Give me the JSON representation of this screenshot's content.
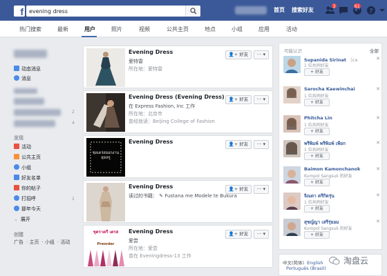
{
  "header": {
    "search_value": "evening dress",
    "home_label": "首页",
    "find_friends_label": "搜索好友",
    "friend_requests_badge": "3",
    "notifications_badge": "61"
  },
  "tabs": [
    {
      "label": "热门搜索"
    },
    {
      "label": "最新"
    },
    {
      "label": "用户"
    },
    {
      "label": "照片"
    },
    {
      "label": "视频"
    },
    {
      "label": "公共主页"
    },
    {
      "label": "地点"
    },
    {
      "label": "小组"
    },
    {
      "label": "应用"
    },
    {
      "label": "活动"
    }
  ],
  "active_tab": "用户",
  "sidebar": {
    "news_feed": "动态消息",
    "messages": "消息",
    "shortcut_counts": [
      "2",
      "4"
    ],
    "explore_heading": "发现",
    "explore_items": [
      {
        "label": "活动",
        "color": "#e9513f"
      },
      {
        "label": "公共主页",
        "color": "#f7923b"
      },
      {
        "label": "小组",
        "color": "#4a8be8"
      },
      {
        "label": "好友名单",
        "color": "#4a8be8"
      },
      {
        "label": "你的帖子",
        "color": "#e9513f"
      },
      {
        "label": "打招呼",
        "color": "#4a8be8",
        "count": "1"
      },
      {
        "label": "那年今天",
        "color": "#4a8be8"
      }
    ],
    "more": "展开",
    "create_heading": "创建",
    "create_links": [
      "广告",
      "主页",
      "小组",
      "活动"
    ]
  },
  "results": [
    {
      "title": "Evening Dress",
      "lines": [
        {
          "text": "爱特雷",
          "style": "main"
        },
        {
          "text": "所在地：爱特雷",
          "style": "sub"
        }
      ],
      "add_friend": "+ 好友",
      "more": "··· ▾"
    },
    {
      "title": "Evening Dress (Evening Dress)",
      "lines": [
        {
          "text": "在 Express Fashion, Inc 工作",
          "style": "main"
        },
        {
          "text": "所在地：北京市",
          "style": "sub"
        },
        {
          "text": "曾经就读：Beijing College of Fashion",
          "style": "sub"
        }
      ],
      "add_friend": "+ 好友",
      "more": "··· ▾"
    },
    {
      "title": "Evening Dress",
      "lines": [],
      "add_friend": "+ 好友",
      "more": "··· ▾",
      "thumb_text": "ชุดเดรสออกงานสุดหรู"
    },
    {
      "title": "Evening Dress",
      "lines": [
        {
          "text": "读过的书籍： ✎ Fustana me Modele te Bukura",
          "style": "main"
        }
      ],
      "add_friend": "+ 好友",
      "more": "··· ▾"
    },
    {
      "title": "Evening Dress",
      "lines": [
        {
          "text": "爱尝",
          "style": "main"
        },
        {
          "text": "所在地：爱尝",
          "style": "sub"
        },
        {
          "text": "曾在 Eveningdress-13 工作",
          "style": "sub"
        }
      ],
      "add_friend": "+ 好友",
      "more": "··· ▾",
      "thumb_text": "ชุดราตรี เดรส",
      "thumb_sub": "Preorder"
    }
  ],
  "suggestions": {
    "heading": "可能认识",
    "see_all": "全部",
    "add_label": "+ 好友",
    "people": [
      {
        "name": "Supanida Sirinat",
        "extra": "（ca",
        "mutual": "1 位共同好友"
      },
      {
        "name": "Sarocha Kaewinchai",
        "extra": "",
        "mutual": "1 位共同好友"
      },
      {
        "name": "Phitcha Lin",
        "extra": "",
        "mutual": "1 位共同好友"
      },
      {
        "name": "พรีพิมพ์ พรีพิมพ์ เพียก",
        "extra": "",
        "mutual": "1 位共同好友"
      },
      {
        "name": "Baimon Kamonchanok",
        "extra": "",
        "mutual": "Kumpol Sangsuk 的好友"
      },
      {
        "name": "จิณดา ตรีกิตรุ่น",
        "extra": "",
        "mutual": "1 位共同好友"
      },
      {
        "name": "สุชญ์ญา เสรีรุ่ยอม",
        "extra": "",
        "mutual": "Kumpol Sangsuk 的好友"
      }
    ]
  },
  "languages": {
    "current": "中文(简体)",
    "english": "English",
    "portuguese": "Português (Brasil)"
  },
  "watermark": "淘盘云"
}
